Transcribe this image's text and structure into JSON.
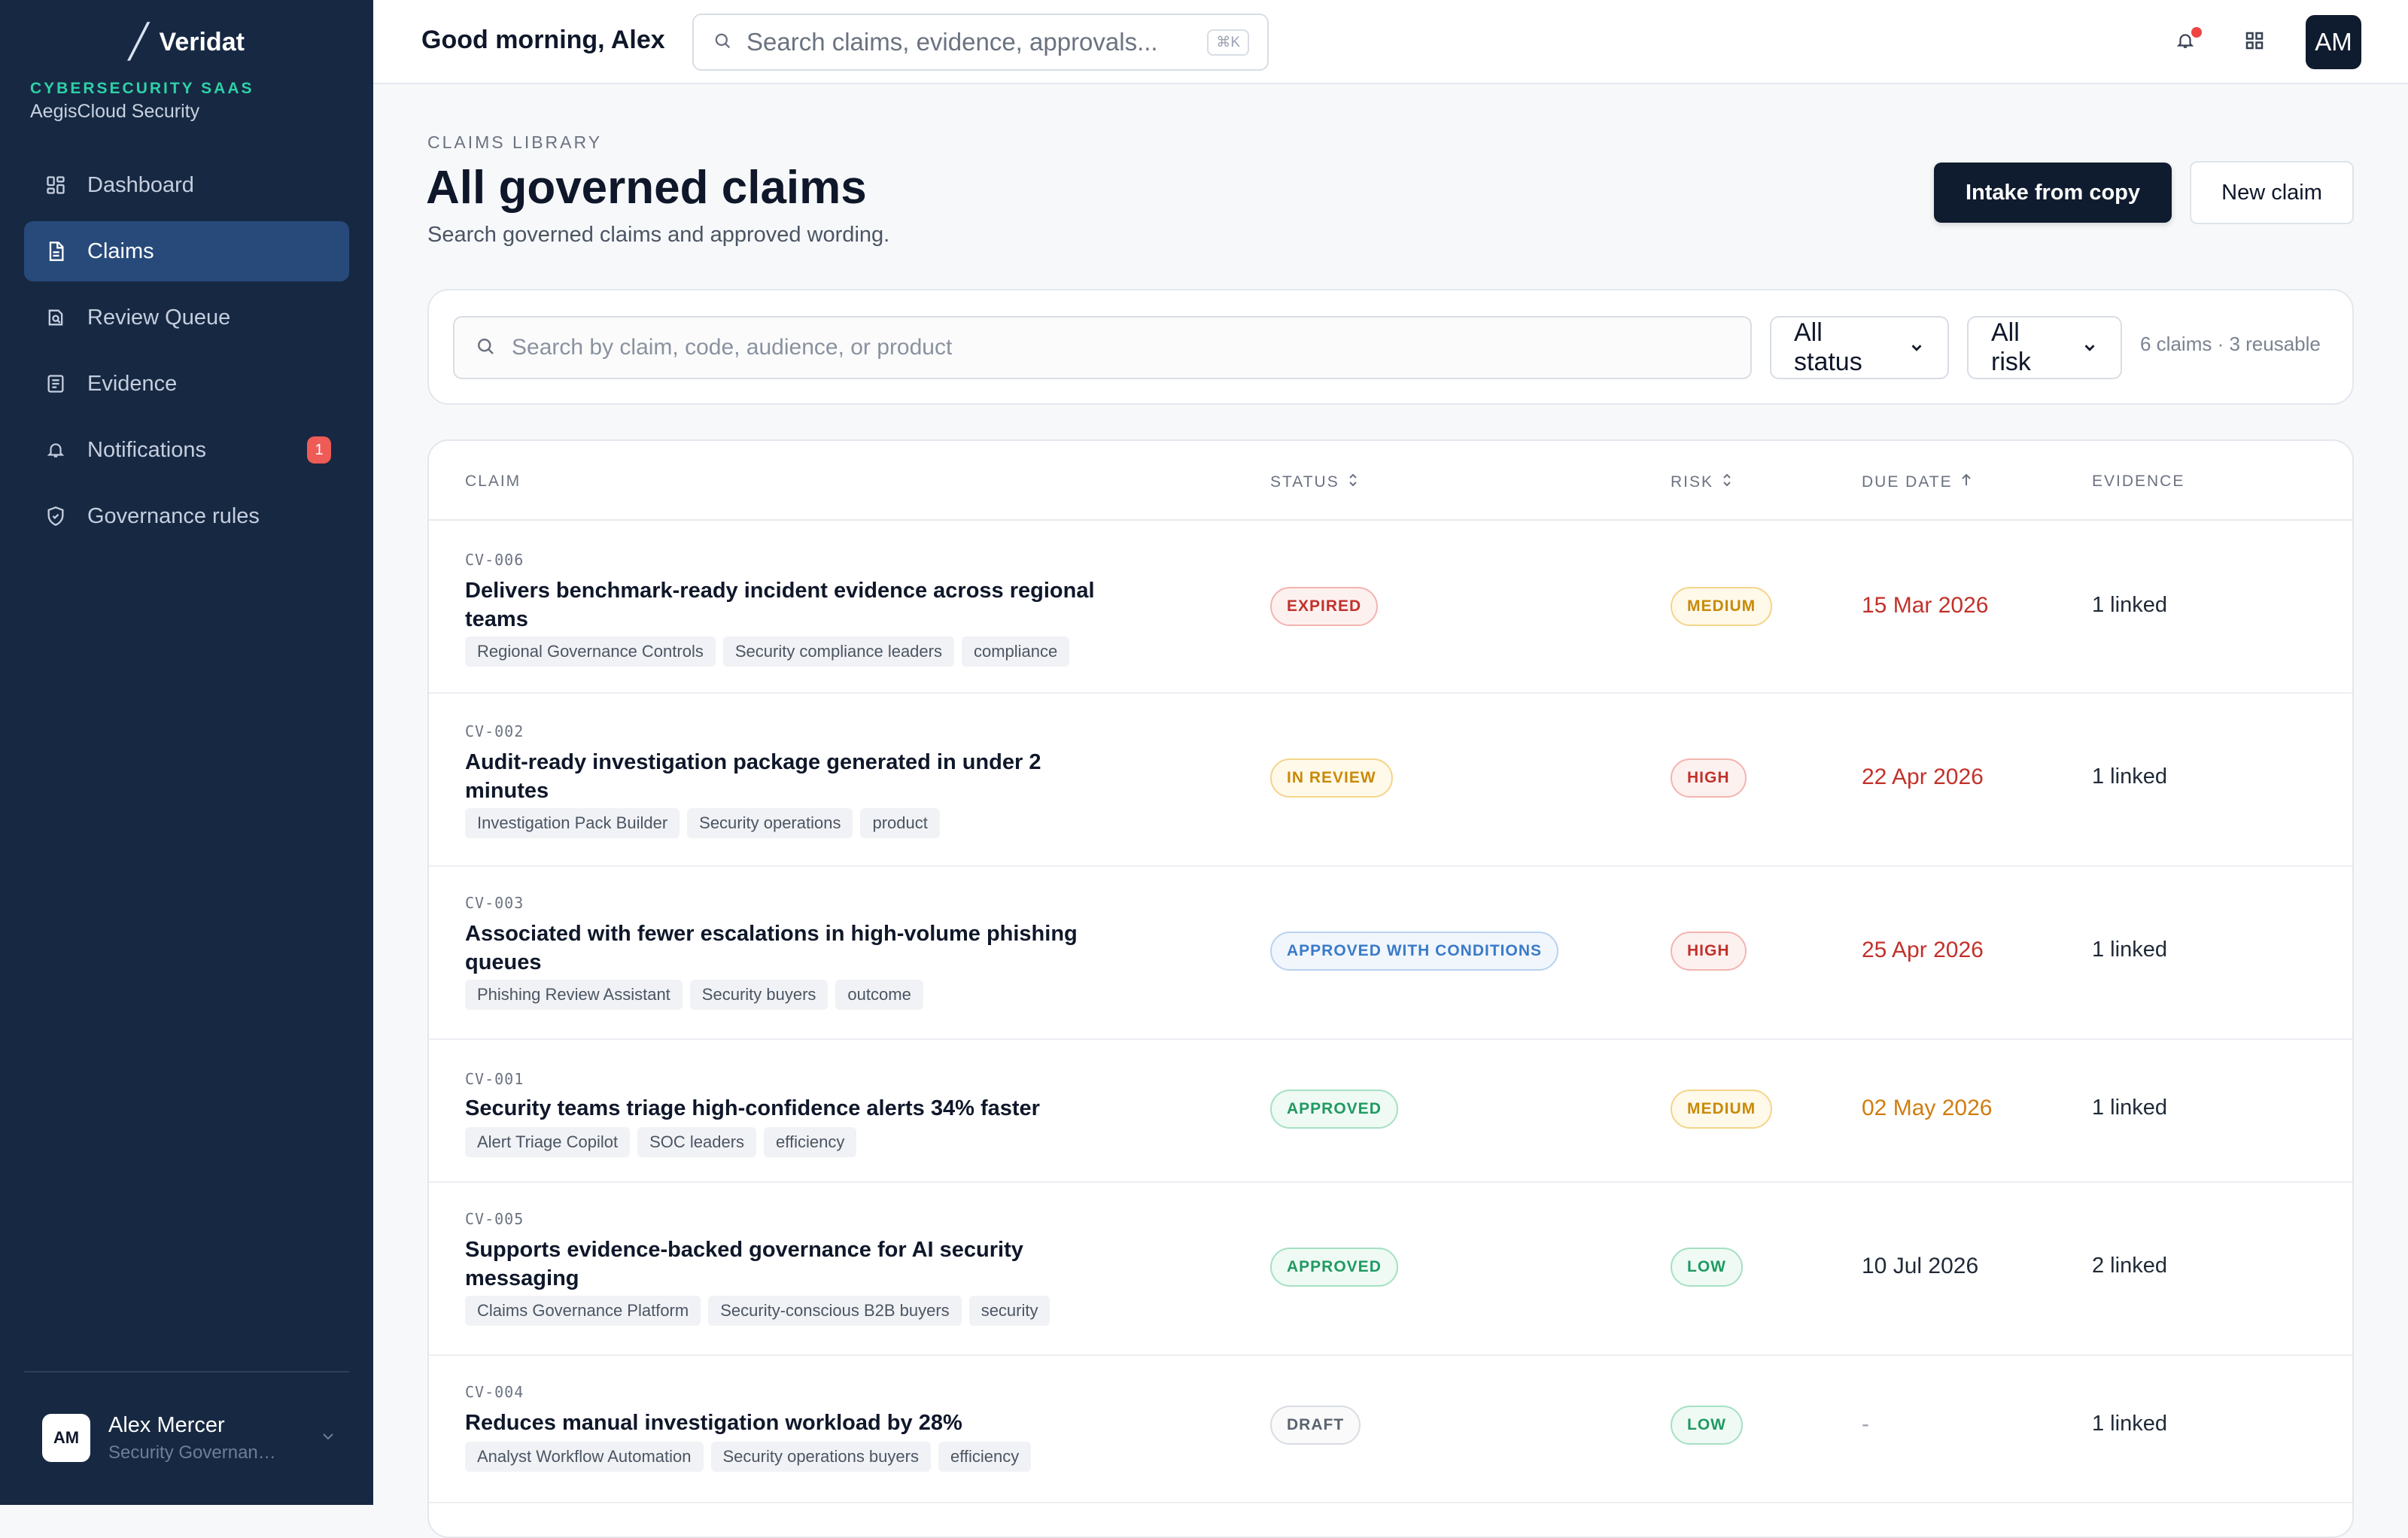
{
  "app": {
    "name": "Veridat",
    "org_kicker": "CYBERSECURITY SAAS",
    "org_name": "AegisCloud Security"
  },
  "sidebar": {
    "items": [
      {
        "label": "Dashboard",
        "icon": "dashboard-icon"
      },
      {
        "label": "Claims",
        "icon": "document-icon",
        "active": true
      },
      {
        "label": "Review Queue",
        "icon": "review-icon"
      },
      {
        "label": "Evidence",
        "icon": "evidence-icon"
      },
      {
        "label": "Notifications",
        "icon": "bell-icon",
        "count": "1"
      },
      {
        "label": "Governance rules",
        "icon": "shield-icon"
      }
    ],
    "user": {
      "initials": "AM",
      "name": "Alex Mercer",
      "role": "Security Governan…"
    }
  },
  "topbar": {
    "greeting": "Good morning, Alex",
    "search_placeholder": "Search claims, evidence, approvals...",
    "shortcut": "⌘K",
    "avatar": "AM"
  },
  "page": {
    "kicker": "CLAIMS LIBRARY",
    "title": "All governed claims",
    "subtitle": "Search governed claims and approved wording.",
    "primary_button": "Intake from copy",
    "secondary_button": "New claim"
  },
  "filters": {
    "search_placeholder": "Search by claim, code, audience, or product",
    "status_value": "All status",
    "risk_value": "All risk",
    "count_text": "6 claims · 3 reusable"
  },
  "table": {
    "headers": {
      "claim": "CLAIM",
      "status": "STATUS",
      "risk": "RISK",
      "due": "DUE DATE",
      "evidence": "EVIDENCE"
    },
    "rows": [
      {
        "code": "CV-006",
        "title": "Delivers benchmark-ready incident evidence across regional teams",
        "tags": [
          "Regional Governance Controls",
          "Security compliance leaders",
          "compliance"
        ],
        "status": "EXPIRED",
        "risk": "MEDIUM",
        "due": "15 Mar 2026",
        "evidence": "1 linked"
      },
      {
        "code": "CV-002",
        "title": "Audit-ready investigation package generated in under 2 minutes",
        "tags": [
          "Investigation Pack Builder",
          "Security operations",
          "product"
        ],
        "status": "IN REVIEW",
        "risk": "HIGH",
        "due": "22 Apr 2026",
        "evidence": "1 linked"
      },
      {
        "code": "CV-003",
        "title": "Associated with fewer escalations in high-volume phishing queues",
        "tags": [
          "Phishing Review Assistant",
          "Security buyers",
          "outcome"
        ],
        "status": "APPROVED WITH CONDITIONS",
        "risk": "HIGH",
        "due": "25 Apr 2026",
        "evidence": "1 linked"
      },
      {
        "code": "CV-001",
        "title": "Security teams triage high-confidence alerts 34% faster",
        "tags": [
          "Alert Triage Copilot",
          "SOC leaders",
          "efficiency"
        ],
        "status": "APPROVED",
        "risk": "MEDIUM",
        "due": "02 May 2026",
        "evidence": "1 linked"
      },
      {
        "code": "CV-005",
        "title": "Supports evidence-backed governance for AI security messaging",
        "tags": [
          "Claims Governance Platform",
          "Security-conscious B2B buyers",
          "security"
        ],
        "status": "APPROVED",
        "risk": "LOW",
        "due": "10 Jul 2026",
        "evidence": "2 linked"
      },
      {
        "code": "CV-004",
        "title": "Reduces manual investigation workload by 28%",
        "tags": [
          "Analyst Workflow Automation",
          "Security operations buyers",
          "efficiency"
        ],
        "status": "DRAFT",
        "risk": "LOW",
        "due": "-",
        "evidence": "1 linked"
      }
    ]
  }
}
